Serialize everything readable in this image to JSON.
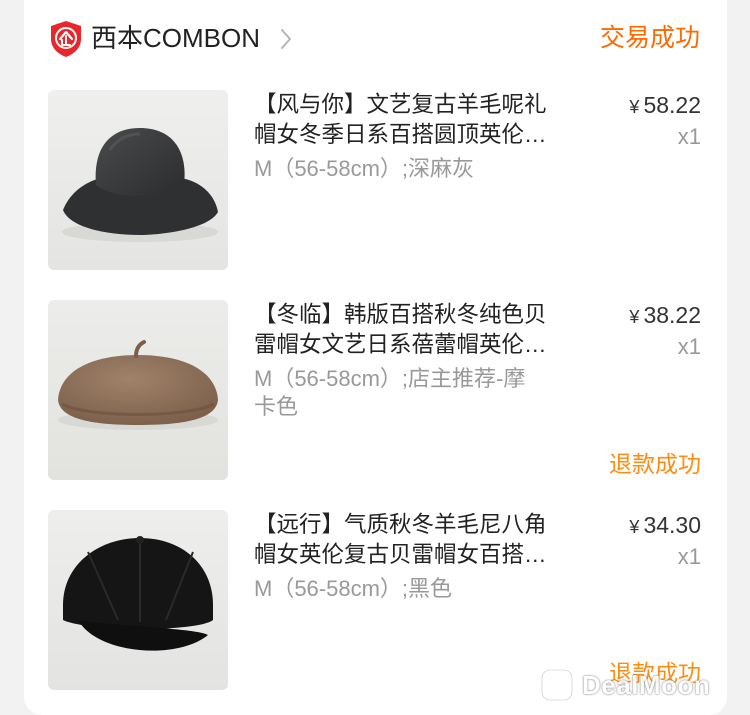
{
  "shop": {
    "name": "西本COMBON",
    "logo_icon": "enterprise-shield-icon",
    "chevron_icon": "chevron-right-icon"
  },
  "order": {
    "status": "交易成功"
  },
  "items": [
    {
      "title_line1": "【风与你】文艺复古羊毛呢礼",
      "title_line2": "帽女冬季日系百搭圆顶英伦…",
      "spec": "M（56-58cm）;深麻灰",
      "spec_line2": "",
      "currency": "¥",
      "price": "58.22",
      "qty": "x1",
      "refund": "",
      "image": "dark-gray-wool-bucket-hat"
    },
    {
      "title_line1": "【冬临】韩版百搭秋冬纯色贝",
      "title_line2": "雷帽女文艺日系蓓蕾帽英伦…",
      "spec": "M（56-58cm）;店主推荐-摩",
      "spec_line2": "卡色",
      "currency": "¥",
      "price": "38.22",
      "qty": "x1",
      "refund": "退款成功",
      "image": "mocha-beret"
    },
    {
      "title_line1": "【远行】气质秋冬羊毛尼八角",
      "title_line2": "帽女英伦复古贝雷帽女百搭…",
      "spec": "M（56-58cm）;黑色",
      "spec_line2": "",
      "currency": "¥",
      "price": "34.30",
      "qty": "x1",
      "refund": "退款成功",
      "image": "black-newsboy-cap"
    }
  ],
  "watermark": {
    "text": "DealMoon",
    "icon": "dealmoon-logo-icon"
  },
  "colors": {
    "accent_orange": "#ff6a00",
    "refund_orange": "#ff8c10",
    "logo_red": "#e8262c"
  }
}
